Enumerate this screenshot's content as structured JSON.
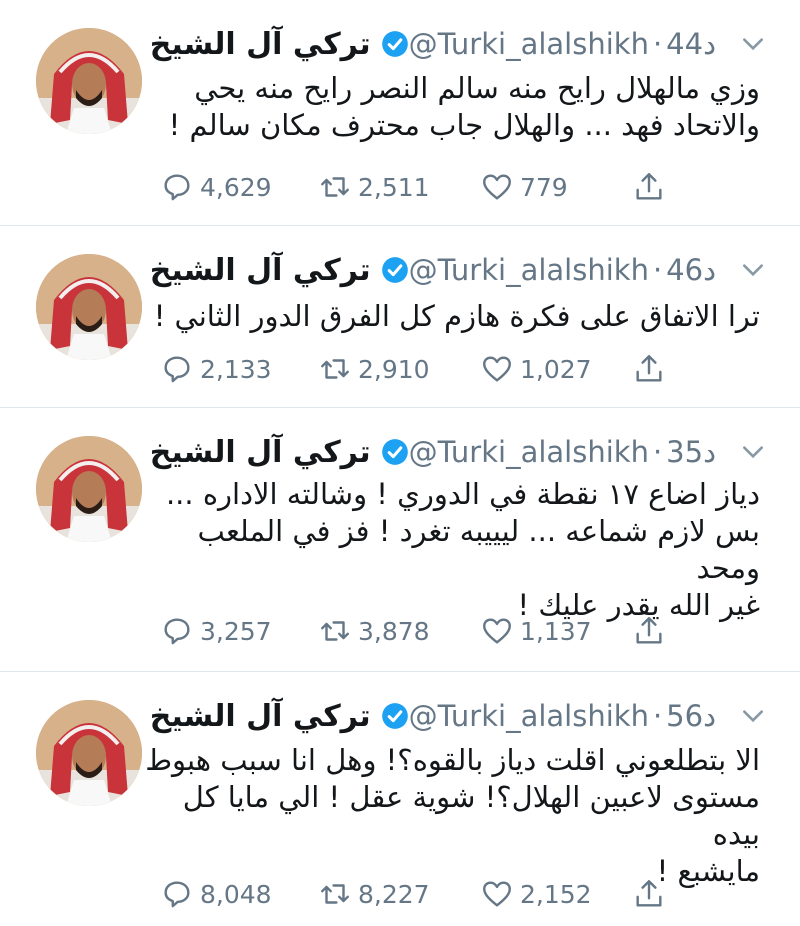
{
  "tweets": [
    {
      "author": "تركي آل الشيخ",
      "handle": "@Turki_alalshikh",
      "time_num": "44",
      "time_unit": "د",
      "lines": [
        "وزي مالهلال رايح منه سالم النصر رايح منه يحي",
        "والاتحاد فهد ... والهلال جاب محترف مكان سالم !"
      ],
      "replies": "4,629",
      "retweets": "2,511",
      "likes": "779"
    },
    {
      "author": "تركي آل الشيخ",
      "handle": "@Turki_alalshikh",
      "time_num": "46",
      "time_unit": "د",
      "lines": [
        "ترا الاتفاق على فكرة هازم كل الفرق الدور الثاني !"
      ],
      "replies": "2,133",
      "retweets": "2,910",
      "likes": "1,027"
    },
    {
      "author": "تركي آل الشيخ",
      "handle": "@Turki_alalshikh",
      "time_num": "35",
      "time_unit": "د",
      "lines": [
        "دياز اضاع ١٧ نقطة في الدوري ! وشالته الاداره ...",
        "بس لازم شماعه ... ليييبه تغرد ! فز في الملعب ومحد",
        "غير الله يقدر عليك !"
      ],
      "replies": "3,257",
      "retweets": "3,878",
      "likes": "1,137"
    },
    {
      "author": "تركي آل الشيخ",
      "handle": "@Turki_alalshikh",
      "time_num": "56",
      "time_unit": "د",
      "lines": [
        "الا بتطلعوني اقلت دياز بالقوه؟! وهل انا سبب هبوط",
        "مستوى لاعبين الهلال؟! شوية عقل ! الي مايا كل بيده",
        "مايشبع !"
      ],
      "replies": "8,048",
      "retweets": "8,227",
      "likes": "2,152"
    }
  ],
  "colors": {
    "text": "#14171a",
    "muted": "#657786",
    "verified": "#1da1f2",
    "divider": "#e1e8ed"
  },
  "icons": {
    "reply": "reply-icon",
    "retweet": "retweet-icon",
    "like": "heart-icon",
    "share": "share-icon",
    "verified": "verified-badge-icon",
    "caret": "chevron-down-icon"
  }
}
